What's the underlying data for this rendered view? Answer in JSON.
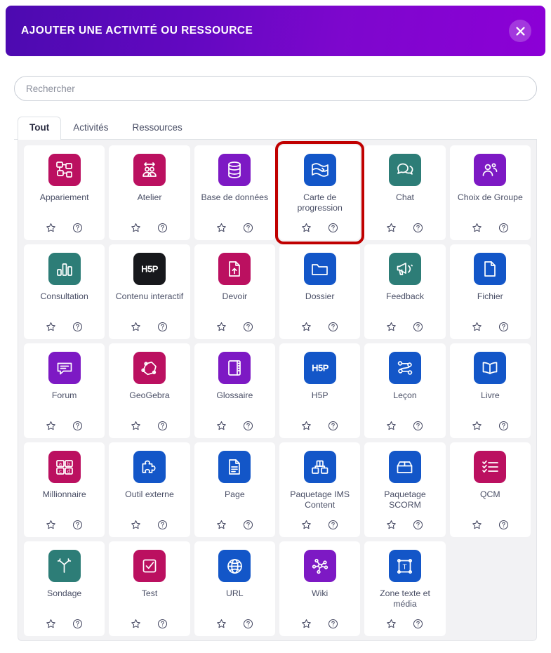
{
  "modal": {
    "title": "AJOUTER UNE ACTIVITÉ OU RESSOURCE",
    "close_label": "×",
    "close_icon": "close-icon",
    "accent_start": "#4c0ab0",
    "accent_end": "#8c00d6",
    "highlight_color": "#c00000"
  },
  "search": {
    "placeholder": "Rechercher",
    "value": ""
  },
  "tabs": [
    {
      "label": "Tout",
      "active": true
    },
    {
      "label": "Activités",
      "active": false
    },
    {
      "label": "Ressources",
      "active": false
    }
  ],
  "actions": {
    "favorite_icon": "star-icon",
    "help_icon": "help-circle-icon"
  },
  "colors": {
    "magenta": "#bb1060",
    "purple": "#7d19c4",
    "blue": "#1356c8",
    "teal": "#2d7d77",
    "black": "#17181c"
  },
  "items": [
    {
      "label": "Appariement",
      "icon": "appariement-icon",
      "color": "#bb1060",
      "highlighted": false
    },
    {
      "label": "Atelier",
      "icon": "atelier-icon",
      "color": "#bb1060",
      "highlighted": false
    },
    {
      "label": "Base de données",
      "icon": "database-icon",
      "color": "#7d19c4",
      "highlighted": false
    },
    {
      "label": "Carte de progression",
      "icon": "flag-map-icon",
      "color": "#1356c8",
      "highlighted": true
    },
    {
      "label": "Chat",
      "icon": "chat-bubbles-icon",
      "color": "#2d7d77",
      "highlighted": false
    },
    {
      "label": "Choix de Groupe",
      "icon": "group-people-icon",
      "color": "#7d19c4",
      "highlighted": false
    },
    {
      "label": "Consultation",
      "icon": "bar-chart-icon",
      "color": "#2d7d77",
      "highlighted": false
    },
    {
      "label": "Contenu interactif",
      "icon": "h5p-logo-icon",
      "color": "#17181c",
      "highlighted": false
    },
    {
      "label": "Devoir",
      "icon": "file-upload-icon",
      "color": "#bb1060",
      "highlighted": false
    },
    {
      "label": "Dossier",
      "icon": "folder-icon",
      "color": "#1356c8",
      "highlighted": false
    },
    {
      "label": "Feedback",
      "icon": "megaphone-icon",
      "color": "#2d7d77",
      "highlighted": false
    },
    {
      "label": "Fichier",
      "icon": "file-icon",
      "color": "#1356c8",
      "highlighted": false
    },
    {
      "label": "Forum",
      "icon": "forum-icon",
      "color": "#7d19c4",
      "highlighted": false
    },
    {
      "label": "GeoGebra",
      "icon": "geogebra-icon",
      "color": "#bb1060",
      "highlighted": false
    },
    {
      "label": "Glossaire",
      "icon": "book-notebook-icon",
      "color": "#7d19c4",
      "highlighted": false
    },
    {
      "label": "H5P",
      "icon": "h5p-text-icon",
      "color": "#1356c8",
      "highlighted": false
    },
    {
      "label": "Leçon",
      "icon": "lesson-path-icon",
      "color": "#1356c8",
      "highlighted": false
    },
    {
      "label": "Livre",
      "icon": "open-book-icon",
      "color": "#1356c8",
      "highlighted": false
    },
    {
      "label": "Millionnaire",
      "icon": "abcd-grid-icon",
      "color": "#bb1060",
      "highlighted": false
    },
    {
      "label": "Outil externe",
      "icon": "puzzle-piece-icon",
      "color": "#1356c8",
      "highlighted": false
    },
    {
      "label": "Page",
      "icon": "page-text-icon",
      "color": "#1356c8",
      "highlighted": false
    },
    {
      "label": "Paquetage IMS Content",
      "icon": "ims-boxes-icon",
      "color": "#1356c8",
      "highlighted": false
    },
    {
      "label": "Paquetage SCORM",
      "icon": "scorm-box-icon",
      "color": "#1356c8",
      "highlighted": false
    },
    {
      "label": "QCM",
      "icon": "checklist-icon",
      "color": "#bb1060",
      "highlighted": false
    },
    {
      "label": "Sondage",
      "icon": "fork-path-icon",
      "color": "#2d7d77",
      "highlighted": false
    },
    {
      "label": "Test",
      "icon": "checkbox-check-icon",
      "color": "#bb1060",
      "highlighted": false
    },
    {
      "label": "URL",
      "icon": "globe-icon",
      "color": "#1356c8",
      "highlighted": false
    },
    {
      "label": "Wiki",
      "icon": "wiki-network-icon",
      "color": "#7d19c4",
      "highlighted": false
    },
    {
      "label": "Zone texte et média",
      "icon": "text-area-icon",
      "color": "#1356c8",
      "highlighted": false
    }
  ]
}
